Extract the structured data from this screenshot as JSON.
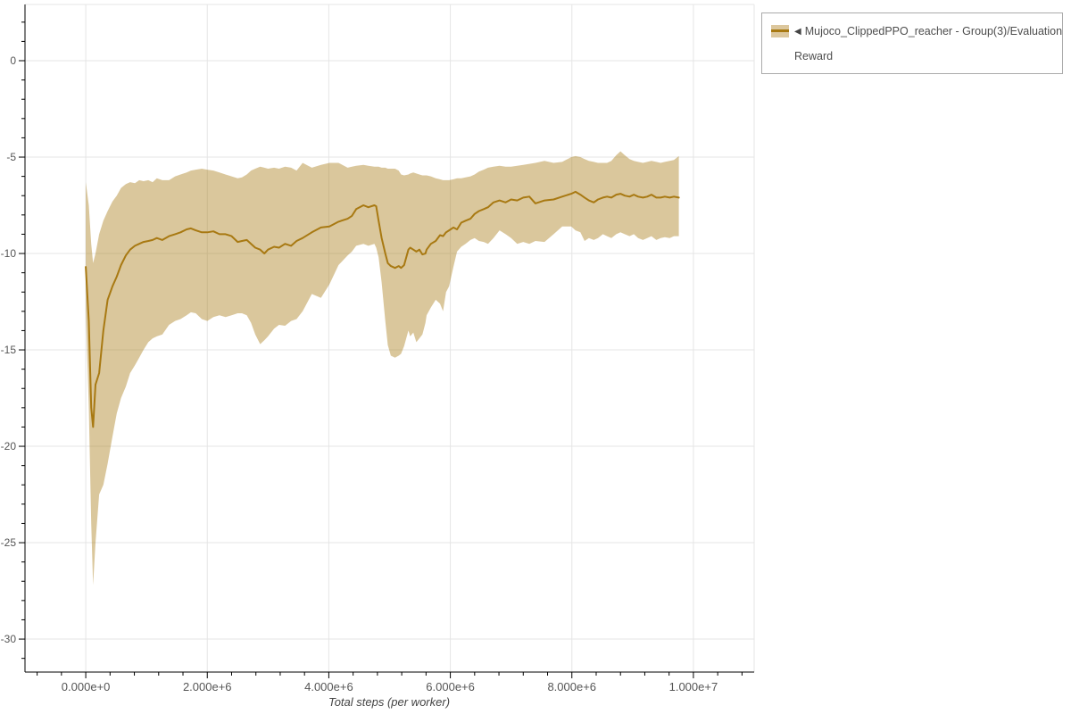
{
  "colors": {
    "background": "#ffffff",
    "grid": "#e5e5e5",
    "axis": "#000000",
    "tick_label": "#555555",
    "axis_title": "#444444",
    "legend_border": "#aaaaaa",
    "legend_text": "#4d4d4d"
  },
  "legend": {
    "marker": "◀",
    "label_line1": "Mujoco_ClippedPPO_reacher - Group(3)/Evaluation",
    "label_line2": "Reward",
    "swatch_fill": "#dcc79d",
    "swatch_line": "#a87912"
  },
  "chart_data": {
    "type": "line",
    "title": "",
    "xlabel": "Total steps (per worker)",
    "ylabel": "",
    "grid": true,
    "legend_position": "top-right-outside",
    "xlim": [
      -1000000,
      11000000
    ],
    "ylim": [
      -31.71,
      2.917
    ],
    "x_major_ticks": [
      {
        "value": 0,
        "label": "0.000e+0"
      },
      {
        "value": 2000000,
        "label": "2.000e+6"
      },
      {
        "value": 4000000,
        "label": "4.000e+6"
      },
      {
        "value": 6000000,
        "label": "6.000e+6"
      },
      {
        "value": 8000000,
        "label": "8.000e+6"
      },
      {
        "value": 10000000,
        "label": "1.000e+7"
      }
    ],
    "x_minor_step": 400000,
    "y_major_ticks": [
      {
        "value": 0,
        "label": "0"
      },
      {
        "value": -5,
        "label": "-5"
      },
      {
        "value": -10,
        "label": "-10"
      },
      {
        "value": -15,
        "label": "-15"
      },
      {
        "value": -20,
        "label": "-20"
      },
      {
        "value": -25,
        "label": "-25"
      },
      {
        "value": -30,
        "label": "-30"
      }
    ],
    "y_minor_step": 1,
    "series": [
      {
        "name": "Mujoco_ClippedPPO_reacher - Group(3)/Evaluation Reward",
        "line_color": "#a87912",
        "band_color": "rgba(168,121,18,0.42)",
        "x": [
          0,
          50000,
          90000,
          120000,
          160000,
          220000,
          290000,
          360000,
          440000,
          510000,
          580000,
          660000,
          730000,
          810000,
          880000,
          950000,
          1030000,
          1100000,
          1170000,
          1260000,
          1370000,
          1470000,
          1560000,
          1660000,
          1730000,
          1810000,
          1910000,
          2000000,
          2100000,
          2200000,
          2300000,
          2400000,
          2500000,
          2570000,
          2650000,
          2720000,
          2790000,
          2870000,
          2940000,
          3000000,
          3100000,
          3180000,
          3280000,
          3380000,
          3470000,
          3570000,
          3720000,
          3870000,
          4010000,
          4160000,
          4310000,
          4380000,
          4450000,
          4570000,
          4650000,
          4750000,
          4780000,
          4820000,
          4870000,
          4930000,
          4970000,
          5020000,
          5090000,
          5150000,
          5190000,
          5240000,
          5310000,
          5340000,
          5390000,
          5440000,
          5490000,
          5540000,
          5590000,
          5610000,
          5680000,
          5760000,
          5830000,
          5880000,
          5930000,
          5980000,
          6050000,
          6110000,
          6180000,
          6250000,
          6330000,
          6400000,
          6470000,
          6550000,
          6620000,
          6710000,
          6810000,
          6910000,
          7000000,
          7100000,
          7200000,
          7300000,
          7400000,
          7550000,
          7700000,
          7840000,
          7990000,
          8060000,
          8140000,
          8210000,
          8280000,
          8360000,
          8430000,
          8510000,
          8580000,
          8650000,
          8730000,
          8800000,
          8870000,
          8950000,
          9020000,
          9090000,
          9170000,
          9240000,
          9310000,
          9390000,
          9460000,
          9530000,
          9610000,
          9680000,
          9760000
        ],
        "mean": [
          -10.7,
          -13.5,
          -18.0,
          -19.0,
          -16.8,
          -16.2,
          -14.0,
          -12.4,
          -11.7,
          -11.2,
          -10.6,
          -10.1,
          -9.8,
          -9.6,
          -9.5,
          -9.4,
          -9.35,
          -9.3,
          -9.2,
          -9.3,
          -9.1,
          -9.0,
          -8.9,
          -8.75,
          -8.7,
          -8.8,
          -8.9,
          -8.9,
          -8.85,
          -9.0,
          -9.0,
          -9.1,
          -9.4,
          -9.35,
          -9.3,
          -9.5,
          -9.7,
          -9.8,
          -10.0,
          -9.8,
          -9.65,
          -9.7,
          -9.5,
          -9.6,
          -9.35,
          -9.2,
          -8.9,
          -8.65,
          -8.6,
          -8.35,
          -8.2,
          -8.05,
          -7.7,
          -7.5,
          -7.6,
          -7.5,
          -7.55,
          -8.3,
          -9.2,
          -10.0,
          -10.5,
          -10.65,
          -10.75,
          -10.65,
          -10.75,
          -10.6,
          -9.8,
          -9.7,
          -9.8,
          -9.9,
          -9.8,
          -10.05,
          -10.0,
          -9.8,
          -9.5,
          -9.35,
          -9.05,
          -9.1,
          -8.9,
          -8.8,
          -8.65,
          -8.75,
          -8.4,
          -8.3,
          -8.2,
          -7.95,
          -7.8,
          -7.7,
          -7.6,
          -7.35,
          -7.25,
          -7.35,
          -7.2,
          -7.25,
          -7.1,
          -7.05,
          -7.4,
          -7.25,
          -7.2,
          -7.05,
          -6.9,
          -6.8,
          -6.95,
          -7.1,
          -7.25,
          -7.35,
          -7.2,
          -7.1,
          -7.05,
          -7.1,
          -6.95,
          -6.9,
          -7.0,
          -7.05,
          -6.95,
          -7.05,
          -7.1,
          -7.05,
          -6.95,
          -7.1,
          -7.1,
          -7.05,
          -7.1,
          -7.05,
          -7.1
        ],
        "upper": [
          -6.3,
          -7.5,
          -9.5,
          -10.5,
          -10.0,
          -9.0,
          -8.3,
          -7.8,
          -7.3,
          -7.0,
          -6.6,
          -6.4,
          -6.3,
          -6.35,
          -6.2,
          -6.25,
          -6.2,
          -6.3,
          -6.1,
          -6.2,
          -6.2,
          -6.0,
          -5.9,
          -5.8,
          -5.7,
          -5.65,
          -5.6,
          -5.65,
          -5.7,
          -5.8,
          -5.9,
          -6.0,
          -6.1,
          -6.05,
          -5.9,
          -5.7,
          -5.6,
          -5.5,
          -5.55,
          -5.6,
          -5.55,
          -5.6,
          -5.5,
          -5.55,
          -5.7,
          -5.3,
          -5.55,
          -5.4,
          -5.3,
          -5.3,
          -5.55,
          -5.5,
          -5.45,
          -5.4,
          -5.45,
          -5.5,
          -5.5,
          -5.5,
          -5.55,
          -5.55,
          -5.6,
          -5.6,
          -5.6,
          -5.7,
          -5.9,
          -5.95,
          -5.9,
          -5.85,
          -5.8,
          -5.85,
          -5.9,
          -5.95,
          -5.95,
          -5.95,
          -6.0,
          -6.1,
          -6.15,
          -6.2,
          -6.2,
          -6.2,
          -6.15,
          -6.1,
          -6.1,
          -6.05,
          -6.0,
          -5.9,
          -5.75,
          -5.65,
          -5.55,
          -5.5,
          -5.45,
          -5.5,
          -5.5,
          -5.45,
          -5.4,
          -5.35,
          -5.3,
          -5.2,
          -5.3,
          -5.25,
          -5.0,
          -4.95,
          -5.0,
          -5.1,
          -5.2,
          -5.25,
          -5.3,
          -5.3,
          -5.3,
          -5.2,
          -4.9,
          -4.7,
          -4.9,
          -5.1,
          -5.2,
          -5.25,
          -5.3,
          -5.25,
          -5.2,
          -5.25,
          -5.3,
          -5.25,
          -5.2,
          -5.15,
          -4.95
        ],
        "lower": [
          -13.0,
          -18.0,
          -24.0,
          -27.2,
          -25.0,
          -22.5,
          -22.0,
          -20.9,
          -19.5,
          -18.3,
          -17.5,
          -16.9,
          -16.2,
          -15.8,
          -15.4,
          -15.0,
          -14.6,
          -14.4,
          -14.3,
          -14.2,
          -13.7,
          -13.5,
          -13.4,
          -13.2,
          -13.05,
          -13.1,
          -13.4,
          -13.5,
          -13.3,
          -13.2,
          -13.3,
          -13.2,
          -13.1,
          -13.1,
          -13.2,
          -13.6,
          -14.2,
          -14.7,
          -14.5,
          -14.3,
          -13.9,
          -13.7,
          -13.75,
          -13.5,
          -13.4,
          -13.0,
          -12.1,
          -12.3,
          -11.6,
          -10.6,
          -10.1,
          -9.9,
          -9.6,
          -9.5,
          -9.6,
          -9.5,
          -9.7,
          -10.2,
          -11.5,
          -13.5,
          -14.75,
          -15.3,
          -15.4,
          -15.3,
          -15.2,
          -14.8,
          -14.0,
          -14.3,
          -14.1,
          -14.6,
          -14.4,
          -14.2,
          -13.6,
          -13.2,
          -12.8,
          -12.4,
          -12.6,
          -13.0,
          -12.0,
          -11.7,
          -10.7,
          -9.9,
          -9.65,
          -9.5,
          -9.3,
          -9.2,
          -9.35,
          -9.4,
          -9.5,
          -9.2,
          -8.8,
          -9.0,
          -9.2,
          -9.5,
          -9.4,
          -9.5,
          -9.35,
          -9.4,
          -9.0,
          -8.6,
          -8.6,
          -8.8,
          -8.9,
          -9.35,
          -9.2,
          -9.3,
          -9.2,
          -9.0,
          -9.1,
          -9.2,
          -9.0,
          -8.9,
          -9.0,
          -9.1,
          -9.0,
          -9.2,
          -9.3,
          -9.2,
          -9.1,
          -9.3,
          -9.2,
          -9.15,
          -9.2,
          -9.1,
          -9.1
        ]
      }
    ]
  }
}
